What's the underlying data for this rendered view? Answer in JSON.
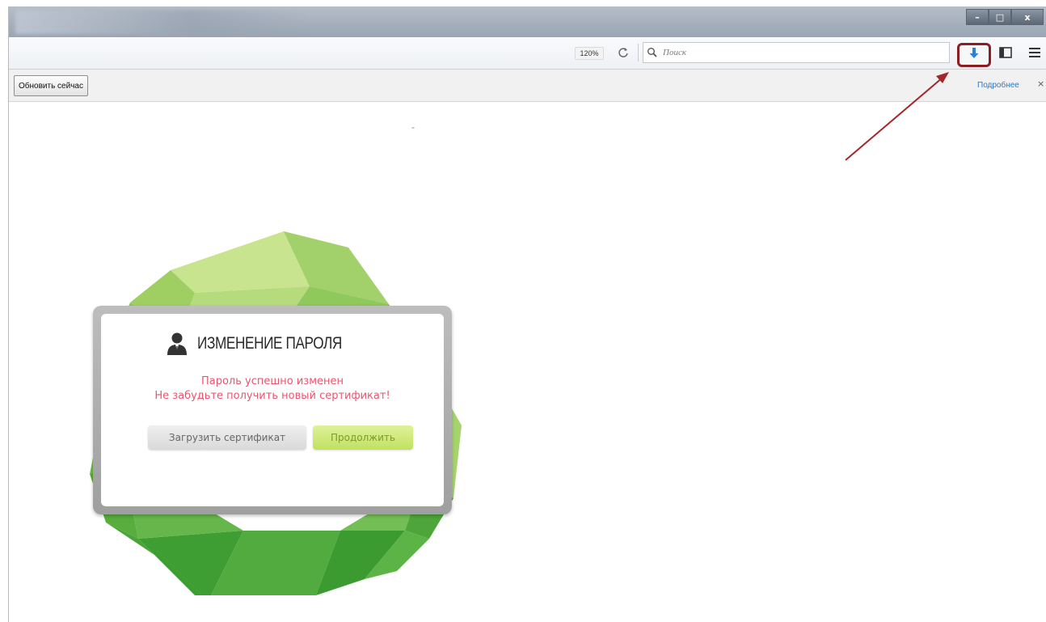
{
  "window": {
    "controls": {
      "minimize": "–",
      "maximize": "□",
      "close": "x"
    }
  },
  "navbar": {
    "zoom": "120%",
    "reload_icon": "reload-icon",
    "search": {
      "placeholder": "Поиск",
      "value": ""
    },
    "download_icon": "download-arrow-icon",
    "sidebar_icon": "sidebar-icon",
    "menu_icon": "hamburger-menu-icon",
    "highlight_color": "#8a1e23"
  },
  "notification": {
    "update_label": "Обновить сейчас",
    "more_link": "Подробнее",
    "close_label": "×"
  },
  "content": {
    "marker": "-"
  },
  "dialog": {
    "icon": "user-icon",
    "title": "ИЗМЕНЕНИЕ ПАРОЛЯ",
    "message_line1": "Пароль успешно изменен",
    "message_line2": "Не забудьте получить новый сертификат!",
    "download_cert_label": "Загрузить сертификат",
    "continue_label": "Продолжить",
    "message_color": "#e8566e",
    "accent_green": "#c1e15e"
  },
  "annotation": {
    "arrow_color": "#a3262b"
  }
}
